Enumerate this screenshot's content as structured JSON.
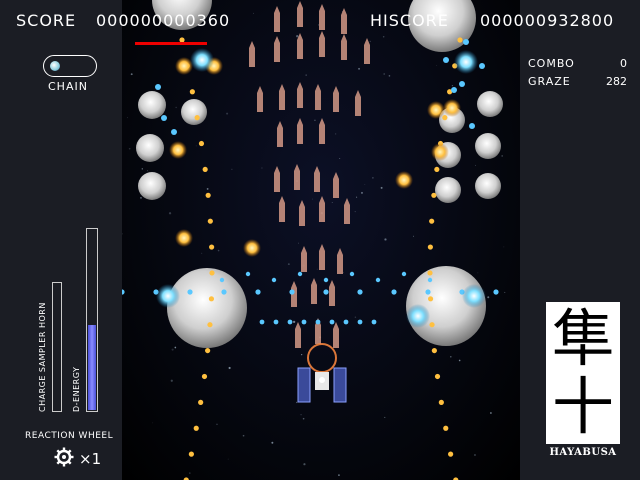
{
  "hud": {
    "score_label": "SCORE",
    "score_value": "000000000360",
    "hiscore_label": "HISCORE",
    "hiscore_value": "000000932800",
    "combo_label": "COMBO",
    "combo_value": "0",
    "graze_label": "GRAZE",
    "graze_value": "282"
  },
  "left_panel": {
    "chain_label": "CHAIN",
    "charge_label": "CHARGE SAMPLER HORN",
    "energy_label": "D-ENERGY",
    "energy_level": 0.47,
    "reaction_wheel_label": "REACTION WHEEL",
    "reaction_wheel_icon": "gear-icon",
    "reaction_wheel_count": "×1"
  },
  "emblem": {
    "kanji_1": "隼",
    "kanji_2": "十",
    "name": "HAYABUSA"
  },
  "colors": {
    "panel": "#1b1d24",
    "score_bar": "#e00000",
    "energy_fill": "#6a6cf0",
    "bullet_blue": "#5ac8ff",
    "bullet_gold": "#ffc040",
    "missile": "#c89080"
  }
}
